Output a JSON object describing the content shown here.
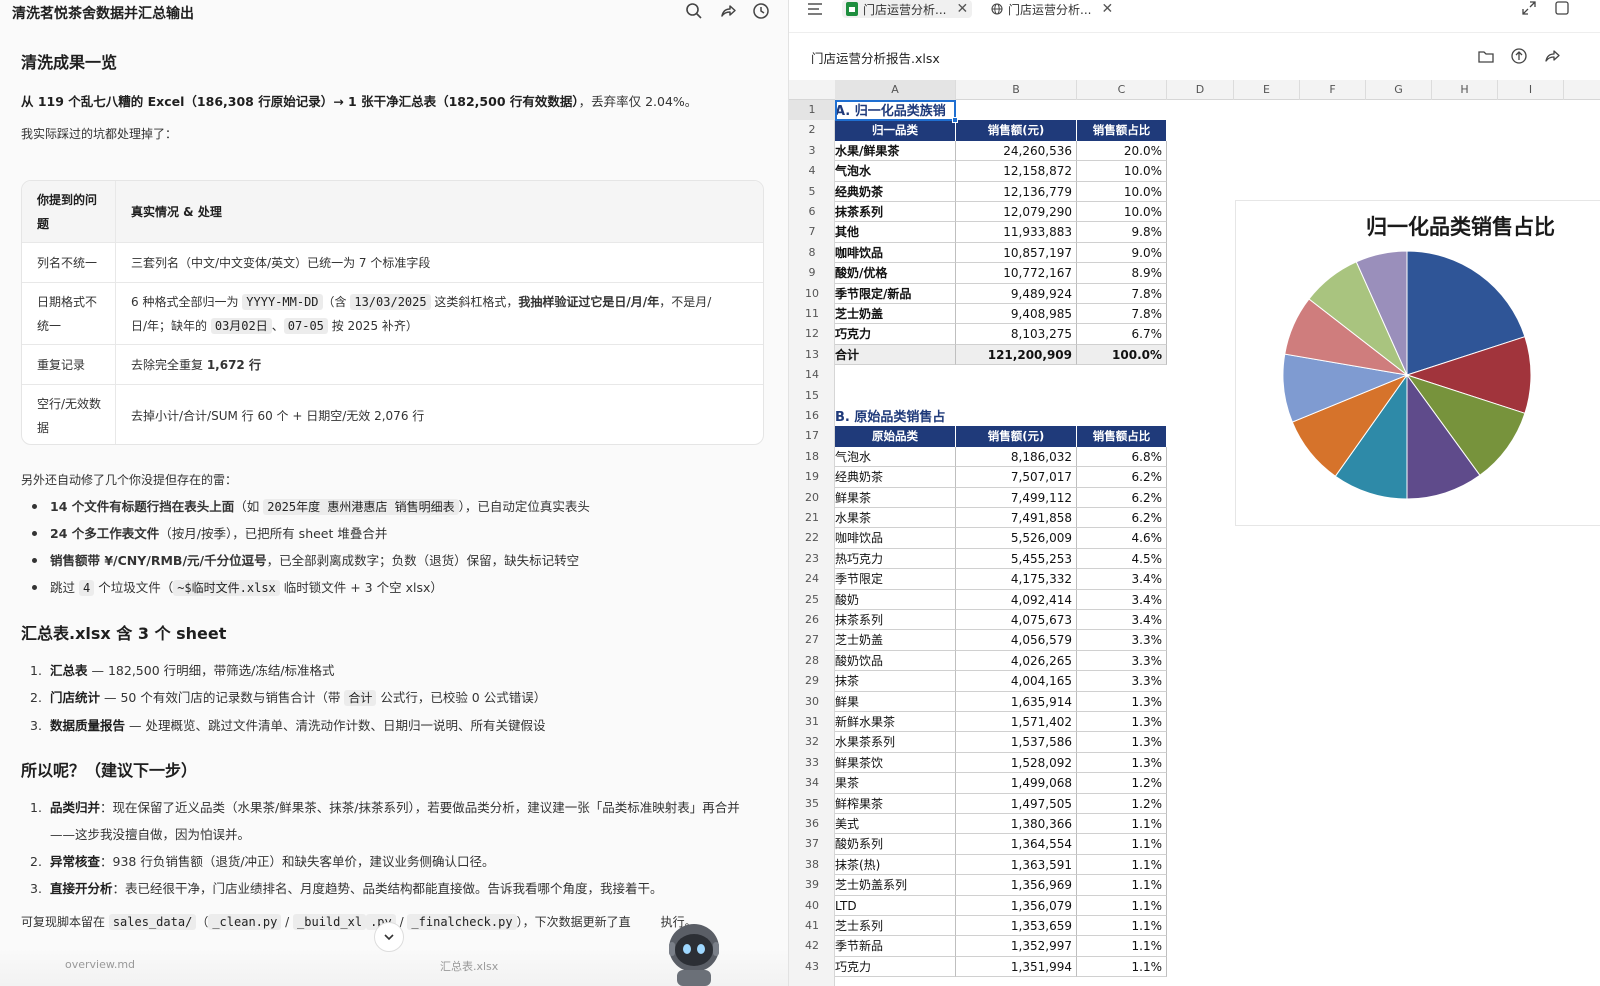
{
  "left": {
    "window_title": "清洗茗悦茶舍数据并汇总输出",
    "section1_title": "清洗成果一览",
    "summary_bold": "从 119 个乱七八糟的 Excel（186,308 行原始记录）→ 1 张干净汇总表（182,500 行有效数据）",
    "summary_rest": "，丢弃率仅 2.04%。",
    "intro": "我实际踩过的坑都处理掉了：",
    "table": {
      "head": [
        "你提到的问题",
        "真实情况 & 处理"
      ],
      "rows": [
        {
          "issue": "列名不统一",
          "desc": "三套列名（中文/中文变体/英文）已统一为 7 个标准字段"
        },
        {
          "issue": "日期格式不统一",
          "desc_parts": [
            "6 种格式全部归一为 ",
            "YYYY-MM-DD",
            "（含 ",
            "13/03/2025",
            " 这类斜杠格式，",
            "我抽样验证过它是日/月/年",
            "，不是月/",
            "日/年；缺年的 ",
            "03月02日",
            "、",
            "07-05",
            " 按 2025 补齐）"
          ]
        },
        {
          "issue": "重复记录",
          "desc_a": "去除完全重复 ",
          "desc_b": "1,672 行"
        },
        {
          "issue": "空行/无效数据",
          "desc": "去掉小计/合计/SUM 行 60 个 + 日期空/无效 2,076 行"
        }
      ]
    },
    "extra_intro": "另外还自动修了几个你没提但存在的雷：",
    "bullets": [
      {
        "bold": "14 个文件有标题行挡在表头上面",
        "pre": "（如 ",
        "code": "2025年度 惠州港惠店 销售明细表",
        "post": "），已自动定位真实表头"
      },
      {
        "bold": "24 个多工作表文件",
        "pre": "（按月/按季），已把所有 sheet 堆叠合并",
        "code": "",
        "post": ""
      },
      {
        "bold": "销售额带 ¥/CNY/RMB/元/千分位逗号",
        "pre": "，已全部剥离成数字；负数（退货）保留，缺失标记转空",
        "code": "",
        "post": ""
      },
      {
        "bold": "",
        "pre": "跳过 ",
        "code": "4",
        "post": " 个垃圾文件（",
        "code2": "~$临时文件.xlsx",
        "post2": " 临时锁文件 + 3 个空 xlsx）"
      }
    ],
    "section2_title": "汇总表.xlsx 含 3 个 sheet",
    "sheets_list": [
      {
        "n": "1.",
        "bold": "汇总表",
        "rest": " — 182,500 行明细，带筛选/冻结/标准格式"
      },
      {
        "n": "2.",
        "bold": "门店统计",
        "rest": " — 50 个有效门店的记录数与销售合计（带 ",
        "code": "合计",
        "rest2": " 公式行，已校验 0 公式错误）"
      },
      {
        "n": "3.",
        "bold": "数据质量报告",
        "rest": " — 处理概览、跳过文件清单、清洗动作计数、日期归一说明、所有关键假设"
      }
    ],
    "section3_title": "所以呢？（建议下一步）",
    "next_list": [
      {
        "n": "1.",
        "bold": "品类归并",
        "rest": "：现在保留了近义品类（水果茶/鲜果茶、抹茶/抹茶系列），若要做品类分析，建议建一张「品类标准映射表」再合并",
        "rest_line2": "——这步我没擅自做，因为怕误并。"
      },
      {
        "n": "2.",
        "bold": "异常核查",
        "rest": "：938 行负销售额（退货/冲正）和缺失客单价，建议业务侧确认口径。"
      },
      {
        "n": "3.",
        "bold": "直接开分析",
        "rest": "：表已经很干净，门店业绩排名、月度趋势、品类结构都能直接做。告诉我看哪个角度，我接着干。"
      }
    ],
    "footer_pre": "可复现脚本留在 ",
    "footer_code1": "sales_data/",
    "footer_mid": "（",
    "footer_code2": "_clean.py",
    "footer_sep": " / ",
    "footer_code3": "_build_xl",
    "footer_code3b": ".py",
    "footer_code4": "_finalcheck.py",
    "footer_post": "），下次数据更新了直",
    "footer_end": "执行。",
    "file_chip1": "overview.md",
    "file_chip2": "汇总表.xlsx"
  },
  "right": {
    "tabs": [
      {
        "label": "门店运营分析...",
        "icon": "spreadsheet-icon"
      },
      {
        "label": "门店运营分析...",
        "icon": "globe-icon"
      }
    ],
    "file_name": "门店运营分析报告.xlsx",
    "columns": [
      "A",
      "B",
      "C",
      "D",
      "E",
      "F",
      "G",
      "H",
      "I"
    ],
    "rows": [
      "1",
      "2",
      "3",
      "4",
      "5",
      "6",
      "7",
      "8",
      "9",
      "10",
      "11",
      "12",
      "13",
      "14",
      "15",
      "16",
      "17",
      "18",
      "19",
      "20",
      "21",
      "22",
      "23",
      "24",
      "25",
      "26",
      "27",
      "28",
      "29",
      "30",
      "31",
      "32",
      "33",
      "34",
      "35",
      "36",
      "37",
      "38",
      "39",
      "40",
      "41",
      "42",
      "43"
    ],
    "sectionA_title": "A. 归一化品类族销",
    "sectionA_header": [
      "归一品类",
      "销售额(元)",
      "销售额占比"
    ],
    "sectionA_rows": [
      [
        "水果/鲜果茶",
        "24,260,536",
        "20.0%"
      ],
      [
        "气泡水",
        "12,158,872",
        "10.0%"
      ],
      [
        "经典奶茶",
        "12,136,779",
        "10.0%"
      ],
      [
        "抹茶系列",
        "12,079,290",
        "10.0%"
      ],
      [
        "其他",
        "11,933,883",
        "9.8%"
      ],
      [
        "咖啡饮品",
        "10,857,197",
        "9.0%"
      ],
      [
        "酸奶/优格",
        "10,772,167",
        "8.9%"
      ],
      [
        "季节限定/新品",
        "9,489,924",
        "7.8%"
      ],
      [
        "芝士奶盖",
        "9,408,985",
        "7.8%"
      ],
      [
        "巧克力",
        "8,103,275",
        "6.7%"
      ]
    ],
    "sectionA_total": [
      "合计",
      "121,200,909",
      "100.0%"
    ],
    "sectionB_title": "B. 原始品类销售占",
    "sectionB_header": [
      "原始品类",
      "销售额(元)",
      "销售额占比"
    ],
    "sectionB_rows": [
      [
        "气泡水",
        "8,186,032",
        "6.8%"
      ],
      [
        "经典奶茶",
        "7,507,017",
        "6.2%"
      ],
      [
        "鲜果茶",
        "7,499,112",
        "6.2%"
      ],
      [
        "水果茶",
        "7,491,858",
        "6.2%"
      ],
      [
        "咖啡饮品",
        "5,526,009",
        "4.6%"
      ],
      [
        "热巧克力",
        "5,455,253",
        "4.5%"
      ],
      [
        "季节限定",
        "4,175,332",
        "3.4%"
      ],
      [
        "酸奶",
        "4,092,414",
        "3.4%"
      ],
      [
        "抹茶系列",
        "4,075,673",
        "3.4%"
      ],
      [
        "芝士奶盖",
        "4,056,579",
        "3.3%"
      ],
      [
        "酸奶饮品",
        "4,026,265",
        "3.3%"
      ],
      [
        "抹茶",
        "4,004,165",
        "3.3%"
      ],
      [
        "鲜果",
        "1,635,914",
        "1.3%"
      ],
      [
        "新鲜水果茶",
        "1,571,402",
        "1.3%"
      ],
      [
        "水果茶系列",
        "1,537,586",
        "1.3%"
      ],
      [
        "鲜果茶饮",
        "1,528,092",
        "1.3%"
      ],
      [
        "果茶",
        "1,499,068",
        "1.2%"
      ],
      [
        "鲜榨果茶",
        "1,497,505",
        "1.2%"
      ],
      [
        "美式",
        "1,380,366",
        "1.1%"
      ],
      [
        "酸奶系列",
        "1,364,554",
        "1.1%"
      ],
      [
        "抹茶(热)",
        "1,363,591",
        "1.1%"
      ],
      [
        "芝士奶盖系列",
        "1,356,969",
        "1.1%"
      ],
      [
        "LTD",
        "1,356,079",
        "1.1%"
      ],
      [
        "芝士系列",
        "1,353,659",
        "1.1%"
      ],
      [
        "季节新品",
        "1,352,997",
        "1.1%"
      ],
      [
        "巧克力",
        "1,351,994",
        "1.1%"
      ]
    ],
    "chart_data": {
      "type": "pie",
      "title": "归一化品类销售占比",
      "categories": [
        "水果/鲜果茶",
        "气泡水",
        "经典奶茶",
        "抹茶系列",
        "其他",
        "咖啡饮品",
        "酸奶/优格",
        "季节限定/新品",
        "芝士奶盖",
        "巧克力"
      ],
      "values": [
        20.0,
        10.0,
        10.0,
        10.0,
        9.8,
        9.0,
        8.9,
        7.8,
        7.8,
        6.7
      ],
      "colors": [
        "#2f5597",
        "#a1343c",
        "#77933c",
        "#5f4b8b",
        "#2e8aa8",
        "#d6732b",
        "#7f9bd1",
        "#cf7d7d",
        "#a9c47f",
        "#9a8fbb"
      ],
      "legend": "none"
    }
  }
}
